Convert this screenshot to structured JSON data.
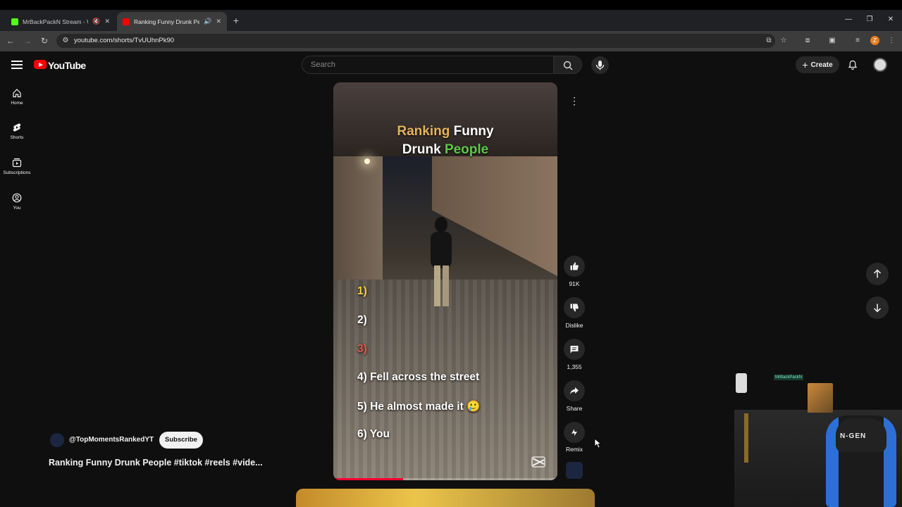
{
  "browser": {
    "tabs": [
      {
        "title": "MrBackPackN Stream - Wa",
        "active": false,
        "favicon_color": "#53fc18",
        "audio_icon": "muted-speaker"
      },
      {
        "title": "Ranking Funny Drunk Peop",
        "active": true,
        "favicon_color": "#ff0000",
        "audio_icon": "speaker"
      }
    ],
    "url": "youtube.com/shorts/TvUUhnPk90",
    "profile_initial": "Z"
  },
  "header": {
    "logo_text": "YouTube",
    "search_placeholder": "Search",
    "create_label": "Create"
  },
  "guide": {
    "items": [
      {
        "label": "Home",
        "icon": "home-icon"
      },
      {
        "label": "Shorts",
        "icon": "shorts-icon"
      },
      {
        "label": "Subscriptions",
        "icon": "subscriptions-icon"
      },
      {
        "label": "You",
        "icon": "you-icon"
      }
    ]
  },
  "video": {
    "overlay_title_part1": "Ranking",
    "overlay_title_part2": "Funny",
    "overlay_title_part3": "Drunk",
    "overlay_title_part4": "People",
    "ranks": [
      {
        "text": "1)",
        "color": "#f5d33c"
      },
      {
        "text": "2)",
        "color": "#ffffff"
      },
      {
        "text": "3)",
        "color": "#e0584f"
      },
      {
        "text": "4) Fell across the street",
        "color": "#ffffff"
      },
      {
        "text": "5) He almost made it 🥲",
        "color": "#ffffff"
      },
      {
        "text": "6) You",
        "color": "#ffffff"
      }
    ],
    "progress": 0.31,
    "title_colors": {
      "ranking": "#e8b45a",
      "people": "#5ec94a"
    }
  },
  "actions": {
    "like_count": "91K",
    "dislike_label": "Dislike",
    "comment_count": "1,355",
    "share_label": "Share",
    "remix_label": "Remix"
  },
  "channel": {
    "handle": "@TopMomentsRankedYT",
    "subscribe_label": "Subscribe",
    "short_title": "Ranking Funny Drunk People #tiktok #reels #vide..."
  },
  "webcam": {
    "chair_brand": "N-GEN",
    "overlay_tag": "MrBackPackN"
  }
}
